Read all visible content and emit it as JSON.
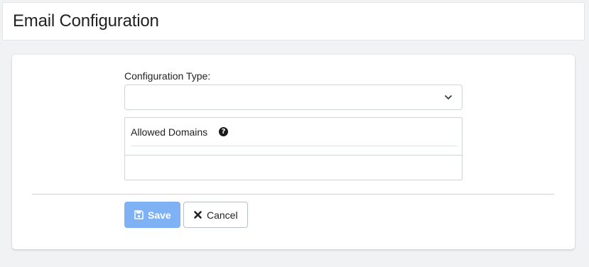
{
  "header": {
    "title": "Email Configuration"
  },
  "form": {
    "configuration_type": {
      "label": "Configuration Type:",
      "value": ""
    },
    "allowed_domains": {
      "label": "Allowed Domains",
      "help_icon": "question-circle-icon",
      "value": ""
    }
  },
  "actions": {
    "save_label": "Save",
    "save_icon": "floppy-disk-icon",
    "cancel_label": "Cancel",
    "cancel_icon": "x-icon"
  },
  "colors": {
    "save_button": "#7fb1f5",
    "page_background": "#f1f2f4"
  }
}
